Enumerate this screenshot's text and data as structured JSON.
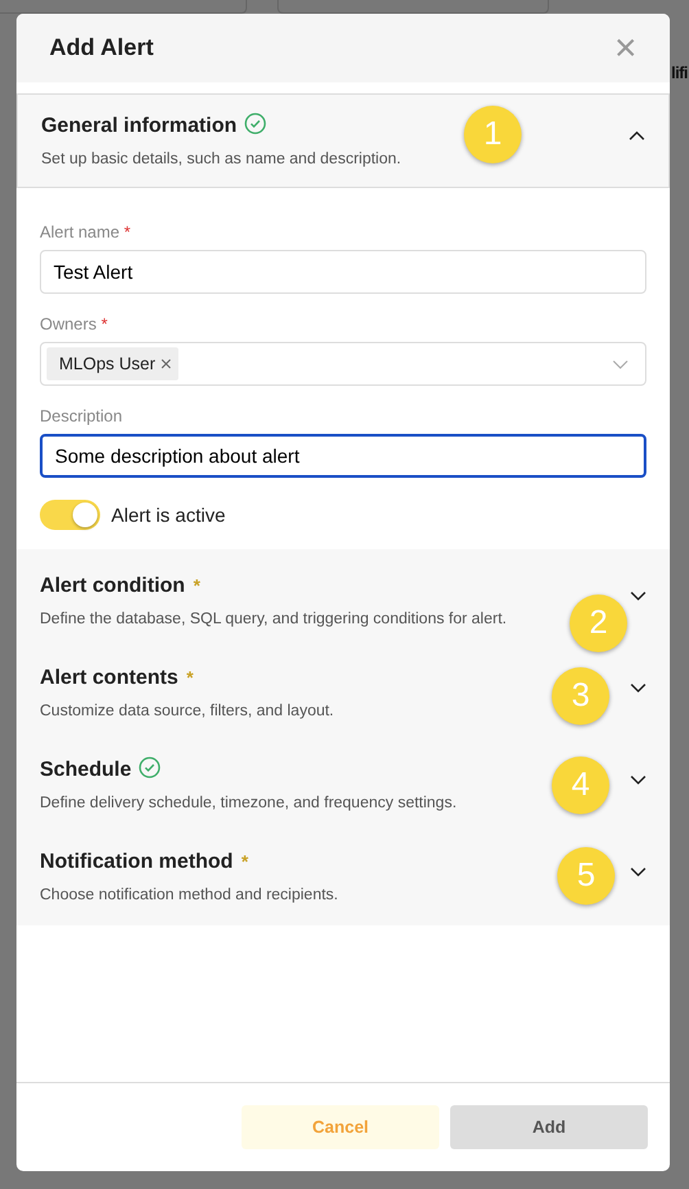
{
  "background_text": "lifi",
  "dialog": {
    "title": "Add Alert",
    "close_label": "×"
  },
  "sections": [
    {
      "title": "General information",
      "description": "Set up basic details, such as name and description.",
      "completed": true,
      "required": false,
      "expanded": true,
      "marker": "1"
    },
    {
      "title": "Alert condition",
      "description": "Define the database, SQL query, and triggering conditions for alert.",
      "completed": false,
      "required": true,
      "expanded": false,
      "marker": "2"
    },
    {
      "title": "Alert contents",
      "description": "Customize data source, filters, and layout.",
      "completed": false,
      "required": true,
      "expanded": false,
      "marker": "3"
    },
    {
      "title": "Schedule",
      "description": "Define delivery schedule, timezone, and frequency settings.",
      "completed": true,
      "required": false,
      "expanded": false,
      "marker": "4"
    },
    {
      "title": "Notification method",
      "description": "Choose notification method and recipients.",
      "completed": false,
      "required": true,
      "expanded": false,
      "marker": "5"
    }
  ],
  "form": {
    "fields": [
      {
        "kind": "text",
        "label": "Alert name",
        "required": true,
        "value": "Test Alert",
        "focused": false
      },
      {
        "kind": "tags",
        "label": "Owners",
        "required": true,
        "tags": [
          "MLOps User"
        ]
      },
      {
        "kind": "text",
        "label": "Description",
        "required": false,
        "value": "Some description about alert",
        "focused": true
      }
    ],
    "toggle": {
      "label": "Alert is active",
      "on": true
    }
  },
  "required_mark": "*",
  "buttons": [
    {
      "label": "Cancel",
      "kind": "secondary"
    },
    {
      "label": "Add",
      "kind": "primary"
    }
  ]
}
